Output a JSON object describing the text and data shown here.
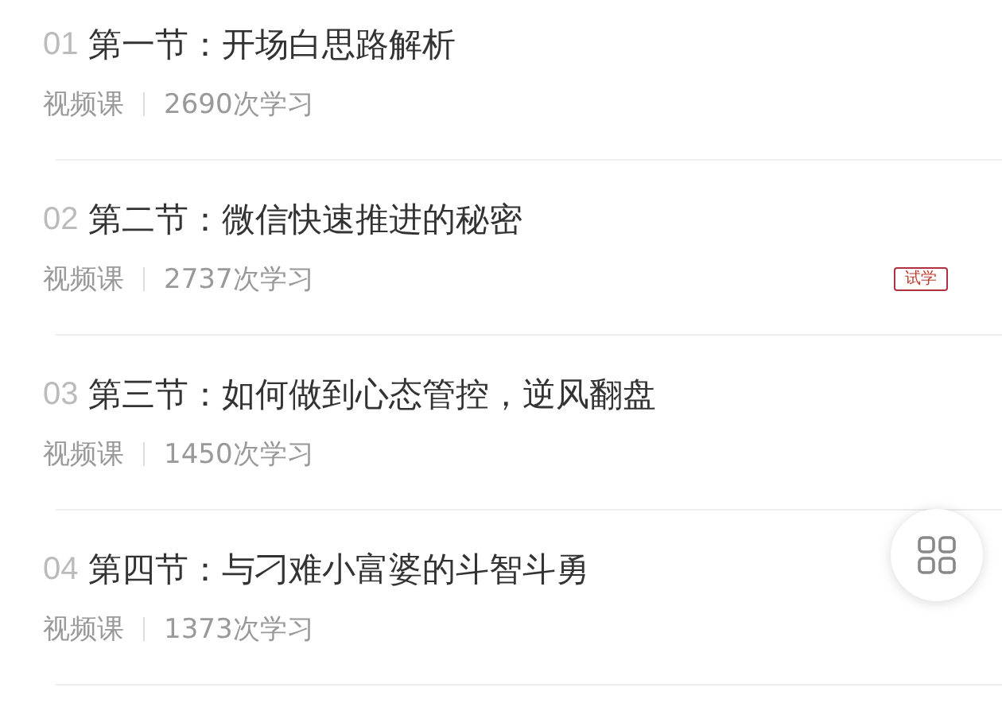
{
  "lessons": [
    {
      "number": "01",
      "title": "第一节：开场白思路解析",
      "type": "视频课",
      "views": "2690次学习",
      "trial": false
    },
    {
      "number": "02",
      "title": "第二节：微信快速推进的秘密",
      "type": "视频课",
      "views": "2737次学习",
      "trial": true,
      "trial_label": "试学"
    },
    {
      "number": "03",
      "title": "第三节：如何做到心态管控，逆风翻盘",
      "type": "视频课",
      "views": "1450次学习",
      "trial": false
    },
    {
      "number": "04",
      "title": "第四节：与刁难小富婆的斗智斗勇",
      "type": "视频课",
      "views": "1373次学习",
      "trial": false
    }
  ],
  "floating_button": {
    "kind": "grid"
  }
}
